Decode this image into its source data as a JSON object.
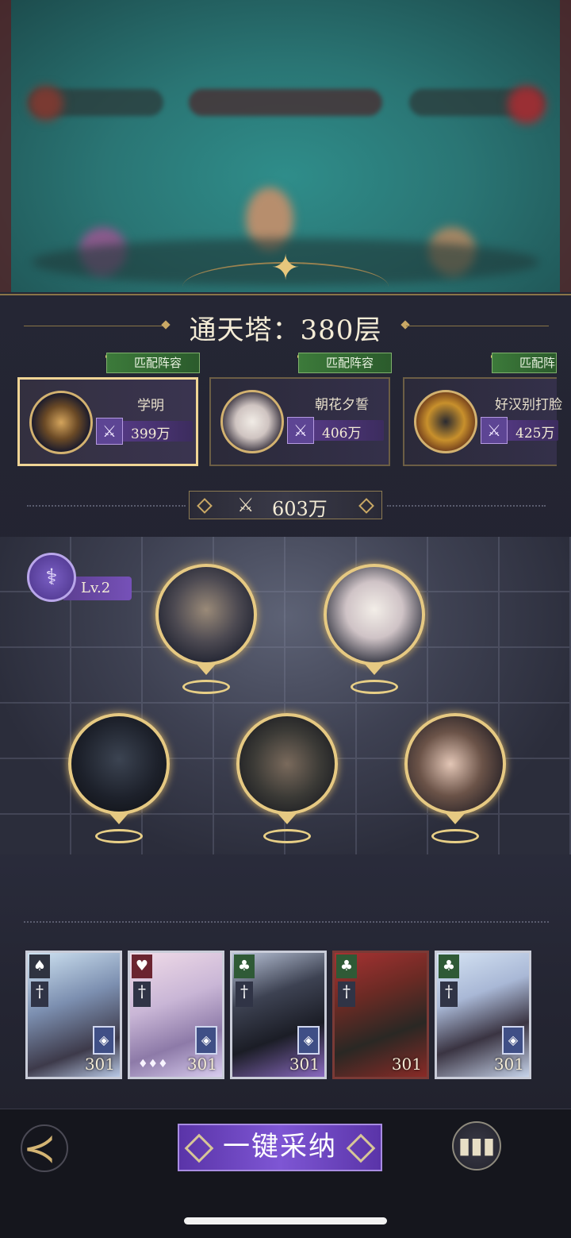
{
  "header": {
    "title": "通天塔：380层"
  },
  "opponents": [
    {
      "name": "学明",
      "power": "399万",
      "tag": "匹配阵容",
      "selected": true
    },
    {
      "name": "朝花夕誓",
      "power": "406万",
      "tag": "匹配阵容",
      "selected": false
    },
    {
      "name": "好汉别打脸",
      "power": "425万",
      "tag": "匹配阵容",
      "selected": false
    }
  ],
  "team": {
    "total_power": "603万",
    "level": "Lv.2"
  },
  "cards": [
    {
      "suit": "spade",
      "level": "301"
    },
    {
      "suit": "heart",
      "level": "301"
    },
    {
      "suit": "club",
      "level": "301"
    },
    {
      "suit": "club",
      "level": "301"
    },
    {
      "suit": "club",
      "level": "301"
    }
  ],
  "actions": {
    "main_button": "一键采纳"
  },
  "icons": {
    "back": "back-arrow-icon",
    "stats": "stats-icon",
    "crest": "compass-star-icon",
    "power": "crossed-swords-icon"
  },
  "colors": {
    "gold": "#e6c982",
    "purple": "#7e56d4",
    "green": "#3c7a3a"
  }
}
